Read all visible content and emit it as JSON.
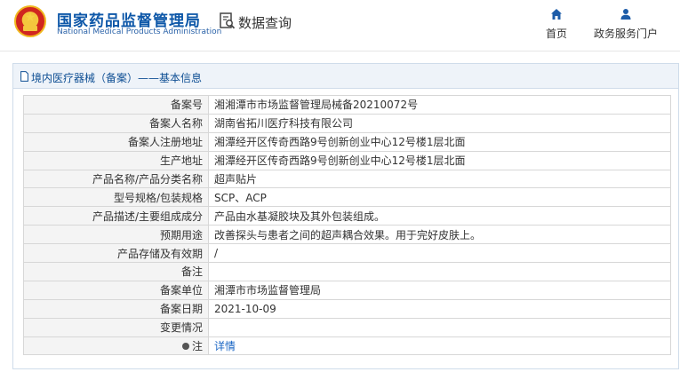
{
  "header": {
    "brand_cn": "国家药品监督管理局",
    "brand_en": "National Medical Products Administration",
    "query_title": "数据查询",
    "nav": [
      {
        "label": "首页",
        "icon": "home-icon"
      },
      {
        "label": "政务服务门户",
        "icon": "user-icon"
      }
    ]
  },
  "panel": {
    "breadcrumb": "境内医疗器械（备案）——基本信息"
  },
  "rows": [
    {
      "label": "备案号",
      "value": "湘湘潭市市场监督管理局械备20210072号"
    },
    {
      "label": "备案人名称",
      "value": "湖南省拓川医疗科技有限公司"
    },
    {
      "label": "备案人注册地址",
      "value": "湘潭经开区传奇西路9号创新创业中心12号楼1层北面"
    },
    {
      "label": "生产地址",
      "value": "湘潭经开区传奇西路9号创新创业中心12号楼1层北面"
    },
    {
      "label": "产品名称/产品分类名称",
      "value": "超声贴片"
    },
    {
      "label": "型号规格/包装规格",
      "value": "SCP、ACP"
    },
    {
      "label": "产品描述/主要组成成分",
      "value": "产品由水基凝胶块及其外包装组成。"
    },
    {
      "label": "预期用途",
      "value": "改善探头与患者之间的超声耦合效果。用于完好皮肤上。"
    },
    {
      "label": "产品存储及有效期",
      "value": "/"
    },
    {
      "label": "备注",
      "value": ""
    },
    {
      "label": "备案单位",
      "value": "湘潭市市场监督管理局"
    },
    {
      "label": "备案日期",
      "value": "2021-10-09"
    },
    {
      "label": "变更情况",
      "value": ""
    },
    {
      "label": "注",
      "value": "详情"
    }
  ],
  "colors": {
    "brand": "#0d57a8",
    "link": "#1a66c4",
    "panel_header_bg": "#eef3f9",
    "label_bg": "#f4f4f4"
  }
}
